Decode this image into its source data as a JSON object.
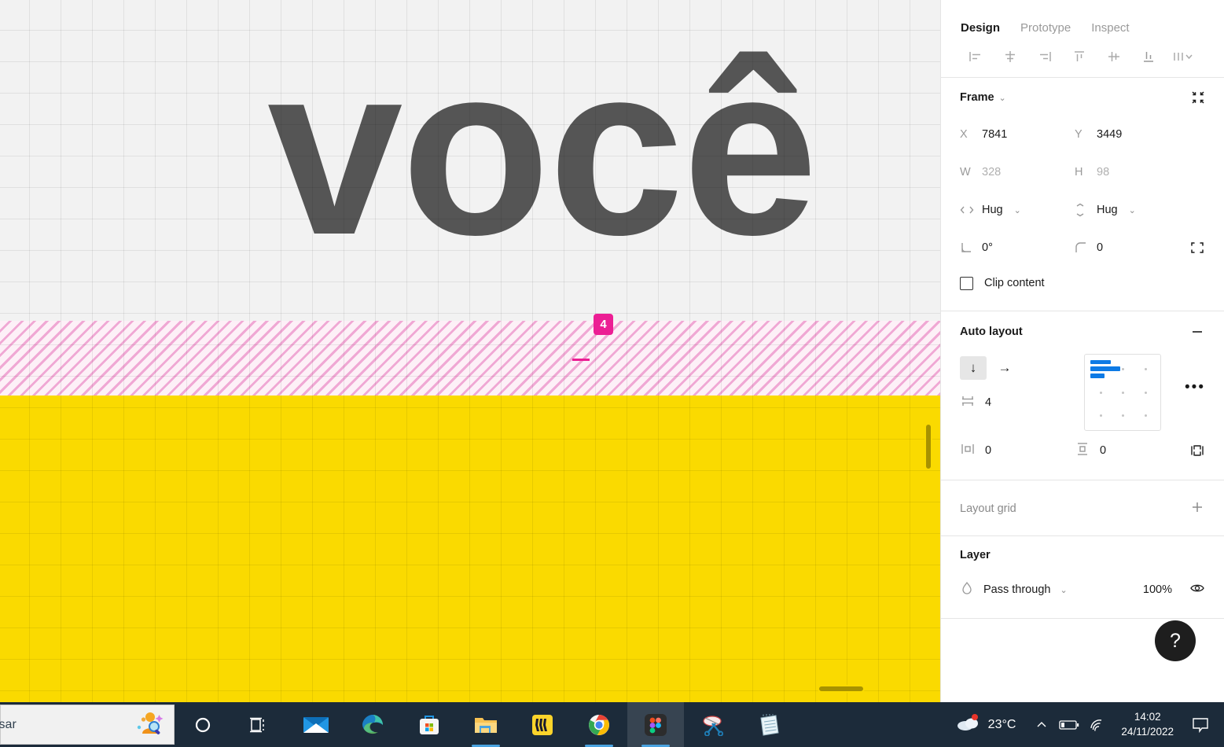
{
  "canvas": {
    "text_layer": "você",
    "spacing_badge": "4",
    "frame_color": "#fada00",
    "hatch_color": "#f0a8d4",
    "badge_color": "#ec1e94",
    "text_color": "#555555",
    "background": "#f2f2f2"
  },
  "panel": {
    "tabs": [
      {
        "label": "Design",
        "active": true
      },
      {
        "label": "Prototype",
        "active": false
      },
      {
        "label": "Inspect",
        "active": false
      }
    ],
    "align_tools": [
      "align-left-icon",
      "align-horizontal-centers-icon",
      "align-right-icon",
      "align-top-icon",
      "align-vertical-centers-icon",
      "align-bottom-icon",
      "distribute-icon"
    ],
    "frame": {
      "title": "Frame",
      "x_label": "X",
      "x_value": "7841",
      "y_label": "Y",
      "y_value": "3449",
      "w_label": "W",
      "w_value": "328",
      "h_label": "H",
      "h_value": "98",
      "resize_w": "Hug",
      "resize_h": "Hug",
      "rotation": "0°",
      "corner_radius": "0",
      "clip_content": "Clip content",
      "clip_checked": false
    },
    "auto_layout": {
      "title": "Auto layout",
      "direction_vertical": "↓",
      "direction_horizontal": "→",
      "direction_selected": "vertical",
      "gap": "4",
      "padding_horizontal": "0",
      "padding_vertical": "0",
      "alignment": "top-left"
    },
    "layout_grid": {
      "title": "Layout grid"
    },
    "layer": {
      "title": "Layer",
      "blend_mode": "Pass through",
      "opacity": "100%"
    },
    "help_button": "?"
  },
  "taskbar": {
    "search_placeholder": "isar",
    "apps": [
      {
        "name": "cortana-icon",
        "active": false,
        "running": false
      },
      {
        "name": "task-view-icon",
        "active": false,
        "running": false
      },
      {
        "name": "mail-icon",
        "active": false,
        "running": false
      },
      {
        "name": "edge-icon",
        "active": false,
        "running": false
      },
      {
        "name": "microsoft-store-icon",
        "active": false,
        "running": false
      },
      {
        "name": "file-explorer-icon",
        "active": false,
        "running": true
      },
      {
        "name": "miro-icon",
        "active": false,
        "running": false
      },
      {
        "name": "chrome-icon",
        "active": false,
        "running": true
      },
      {
        "name": "figma-icon",
        "active": true,
        "running": true
      },
      {
        "name": "snipping-tool-icon",
        "active": false,
        "running": false
      },
      {
        "name": "notepad-icon",
        "active": false,
        "running": false
      }
    ],
    "weather_temp": "23°C",
    "time": "14:02",
    "date": "24/11/2022"
  }
}
